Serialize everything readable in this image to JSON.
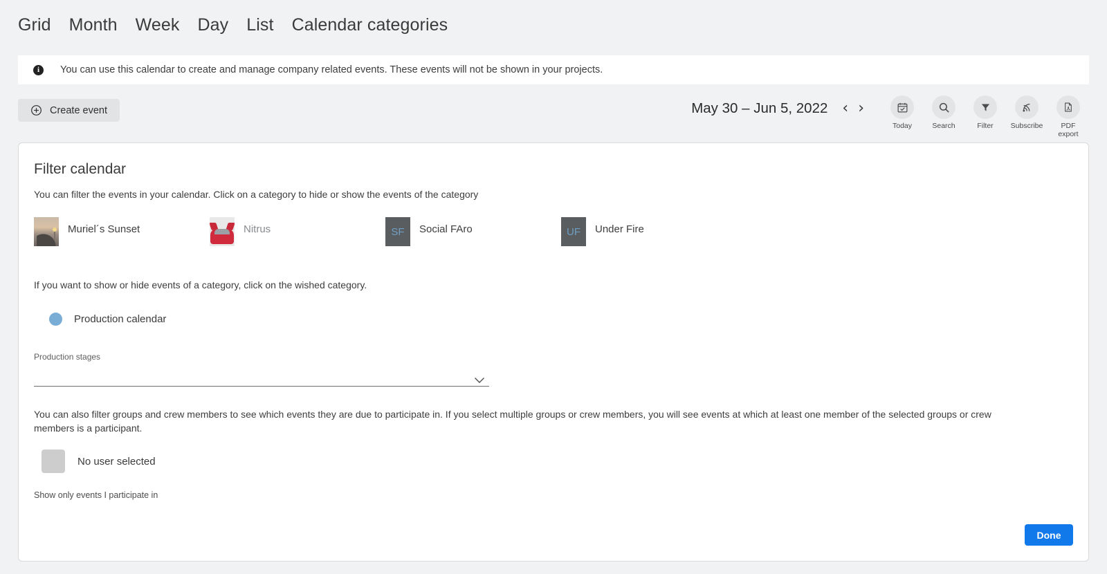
{
  "view_tabs": [
    {
      "label": "Grid",
      "name": "tab-grid"
    },
    {
      "label": "Month",
      "name": "tab-month"
    },
    {
      "label": "Week",
      "name": "tab-week"
    },
    {
      "label": "Day",
      "name": "tab-day"
    },
    {
      "label": "List",
      "name": "tab-list"
    },
    {
      "label": "Calendar categories",
      "name": "tab-calendar-categories"
    }
  ],
  "banner": {
    "icon": "info-icon",
    "text": "You can use this calendar to create and manage company related events. These events will not be shown in your projects."
  },
  "toolbar": {
    "create_event_label": "Create event",
    "create_event_icon": "plus-circle-icon",
    "date_range": "May 30 – Jun 5, 2022",
    "prev_arrow": "‹",
    "next_arrow": "›",
    "tools": [
      {
        "label": "Today",
        "icon": "calendar-check-icon",
        "name": "toolbar-today"
      },
      {
        "label": "Search",
        "icon": "search-icon",
        "name": "toolbar-search"
      },
      {
        "label": "Filter",
        "icon": "funnel-icon",
        "name": "toolbar-filter"
      },
      {
        "label": "Subscribe",
        "icon": "rss-icon",
        "name": "toolbar-subscribe"
      },
      {
        "label": "PDF\nexport",
        "icon": "pdf-file-icon",
        "name": "toolbar-pdf-export"
      }
    ]
  },
  "filter_panel": {
    "title": "Filter calendar",
    "subtitle": "You can filter the events in your calendar. Click on a category to hide or show the events of the category",
    "categories": [
      {
        "label": "Muriel´s Sunset",
        "thumb": "sunset-photo",
        "muted": false
      },
      {
        "label": "Nitrus",
        "thumb": "car-photo",
        "muted": true
      },
      {
        "label": "Social FAro",
        "initials": "SF",
        "muted": false
      },
      {
        "label": "Under Fire",
        "initials": "UF",
        "muted": false
      }
    ],
    "hint": "If you want to show or hide events of a category, click on the wished category.",
    "production_calendar": {
      "label": "Production calendar",
      "dot_color": "#7aadd6"
    },
    "stages_field": {
      "label": "Production stages",
      "value": "",
      "chevron_icon": "chevron-down-icon"
    },
    "crew_text": "You can also filter groups and crew members to see which events they are due to participate in. If you select multiple groups or crew members, you will see events at which at least one member of the selected groups or crew members is a participant.",
    "user_row": {
      "label": "No user selected",
      "avatar": "empty-user-avatar"
    },
    "participate_text": "Show only events I participate in",
    "done_label": "Done",
    "accent_color": "#1179ea"
  }
}
